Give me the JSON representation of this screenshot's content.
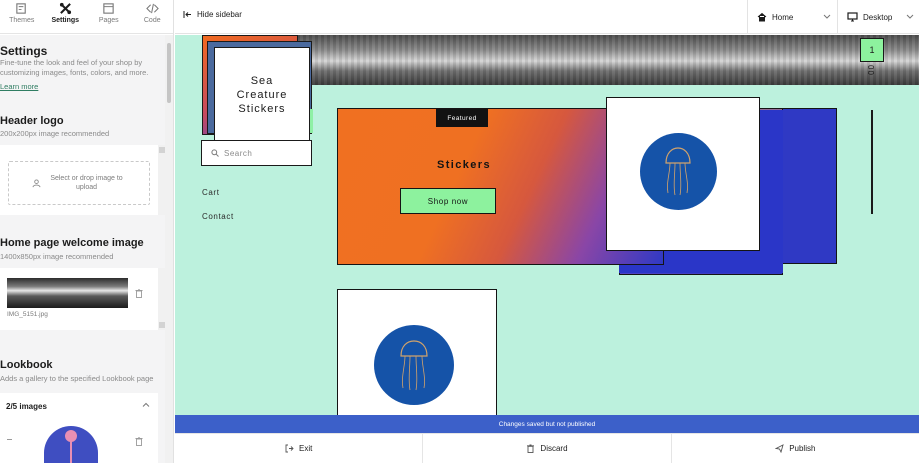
{
  "sidebar": {
    "tabs": [
      {
        "label": "Themes",
        "icon": "paint-icon",
        "active": false
      },
      {
        "label": "Settings",
        "icon": "tools-icon",
        "active": true
      },
      {
        "label": "Pages",
        "icon": "pages-icon",
        "active": false
      },
      {
        "label": "Code",
        "icon": "code-icon",
        "active": false
      }
    ],
    "settings": {
      "title": "Settings",
      "description": "Fine-tune the look and feel of your shop by customizing images, fonts, colors, and more.",
      "learn_more": "Learn more"
    },
    "header_logo": {
      "title": "Header logo",
      "hint": "200x200px image recommended",
      "dropzone_text": "Select or drop image to upload"
    },
    "welcome_image": {
      "title": "Home page welcome image",
      "hint": "1400x850px image recommended",
      "file_name": "IMG_5151.jpg"
    },
    "lookbook": {
      "title": "Lookbook",
      "description": "Adds a gallery to the specified Lookbook page",
      "count": "2/5 images"
    }
  },
  "topbar": {
    "hide_sidebar": "Hide sidebar",
    "page_select": "Home",
    "view_select": "Desktop"
  },
  "preview": {
    "logo_text": "Sea\nCreature\nStickers",
    "search_placeholder": "Search",
    "nav": [
      "Cart",
      "Contact"
    ],
    "featured_tag": "Featured",
    "featured_title": "Stickers",
    "shop_button": "Shop now",
    "cart_count": "1",
    "vertical_text": "00"
  },
  "status": {
    "message": "Changes saved but not published"
  },
  "bottombar": {
    "exit": "Exit",
    "discard": "Discard",
    "publish": "Publish"
  },
  "colors": {
    "canvas_bg": "#bcf1dd",
    "accent_green": "#8df29e",
    "status_blue": "#3c60c9",
    "orange": "#f07021",
    "blue": "#2f39c4"
  }
}
